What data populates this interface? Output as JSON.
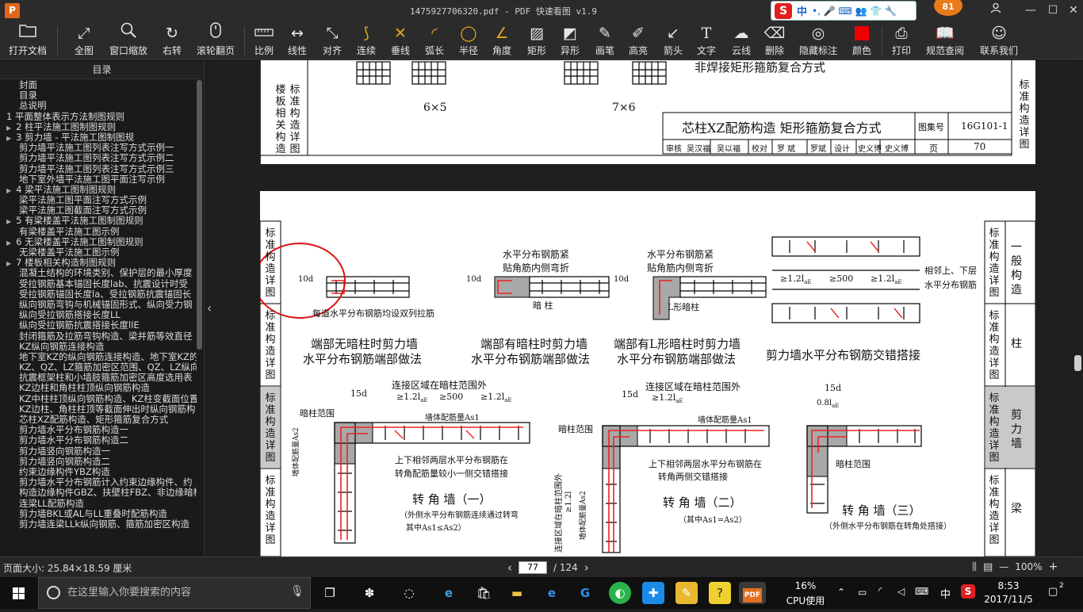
{
  "titlebar": {
    "app_icon": "P",
    "title": "1475927706320.pdf - PDF 快速看图 v1.9",
    "ime": {
      "logo": "S",
      "lang": "中",
      "symbols": "•, 🎤 ⌨ 👥 👕 🔧"
    },
    "badge": "81",
    "buttons": {
      "user": "user-icon",
      "min": "—",
      "max": "☐",
      "close": "✕"
    }
  },
  "toolbar": {
    "items": [
      {
        "label": "打开文档",
        "icon": "folder-icon"
      },
      {
        "label": "全图",
        "icon": "fit-icon"
      },
      {
        "label": "窗口缩放",
        "icon": "zoom-icon"
      },
      {
        "label": "右转",
        "icon": "rotate-right-icon"
      },
      {
        "label": "滚轮翻页",
        "icon": "mouse-icon"
      },
      {
        "label": "比例",
        "icon": "scale-icon"
      },
      {
        "label": "线性",
        "icon": "linear-icon"
      },
      {
        "label": "对齐",
        "icon": "align-icon"
      },
      {
        "label": "连续",
        "icon": "continuous-icon"
      },
      {
        "label": "垂线",
        "icon": "perpendicular-icon"
      },
      {
        "label": "弧长",
        "icon": "arc-length-icon"
      },
      {
        "label": "半径",
        "icon": "radius-icon"
      },
      {
        "label": "角度",
        "icon": "angle-icon"
      },
      {
        "label": "矩形",
        "icon": "rectangle-icon"
      },
      {
        "label": "异形",
        "icon": "irregular-icon"
      },
      {
        "label": "画笔",
        "icon": "pen-icon"
      },
      {
        "label": "高亮",
        "icon": "highlight-icon"
      },
      {
        "label": "箭头",
        "icon": "arrow-icon"
      },
      {
        "label": "文字",
        "icon": "text-icon"
      },
      {
        "label": "云线",
        "icon": "cloud-icon"
      },
      {
        "label": "删除",
        "icon": "eraser-icon"
      },
      {
        "label": "隐藏标注",
        "icon": "hide-icon"
      },
      {
        "label": "颜色",
        "icon": "color-icon",
        "color": "#ee0000"
      },
      {
        "label": "打印",
        "icon": "printer-icon"
      },
      {
        "label": "规范查阅",
        "icon": "book-icon"
      },
      {
        "label": "联系我们",
        "icon": "contact-icon"
      }
    ]
  },
  "sidebar": {
    "title": "目录",
    "items": [
      {
        "text": "封面",
        "level": 0
      },
      {
        "text": "目录",
        "level": 0
      },
      {
        "text": "总说明",
        "level": 0
      },
      {
        "text": "1 平面整体表示方法制图规则",
        "level": 1
      },
      {
        "text": "2 柱平法施工图制图规则",
        "level": 1,
        "arrow": "▶"
      },
      {
        "text": "3 剪力墙 - 平法施工图制图规",
        "level": 1,
        "arrow": "▶"
      },
      {
        "text": "剪力墙平法施工图列表注写方式示例一",
        "level": 2
      },
      {
        "text": "剪力墙平法施工图列表注写方式示例二",
        "level": 2
      },
      {
        "text": "剪力墙平法施工图列表注写方式示例三",
        "level": 2
      },
      {
        "text": "地下室外墙平法施工图平面注写示例",
        "level": 2
      },
      {
        "text": "4 梁平法施工图制图规则",
        "level": 1,
        "arrow": "▶"
      },
      {
        "text": "梁平法施工图平面注写方式示例",
        "level": 2
      },
      {
        "text": "梁平法施工图截面注写方式示例",
        "level": 2
      },
      {
        "text": "5 有梁楼盖平法施工图制图规则",
        "level": 1,
        "arrow": "▶"
      },
      {
        "text": "有梁楼盖平法施工图示例",
        "level": 2
      },
      {
        "text": "6 无梁楼盖平法施工图制图规则",
        "level": 1,
        "arrow": "▶"
      },
      {
        "text": "无梁楼盖平法施工图示例",
        "level": 2
      },
      {
        "text": "7 楼板相关构造制图规则",
        "level": 1,
        "arrow": "▶"
      },
      {
        "text": "混凝土结构的环境类别、保护层的最小厚度",
        "level": 2
      },
      {
        "text": "受拉钢筋基本锚固长度lab、抗震设计时受",
        "level": 2
      },
      {
        "text": "受拉钢筋锚固长度la、受拉钢筋抗震锚固长",
        "level": 2
      },
      {
        "text": "纵向钢筋弯钩与机械锚固形式、纵向受力钢",
        "level": 2
      },
      {
        "text": "纵向受拉钢筋搭接长度LL",
        "level": 2
      },
      {
        "text": "纵向受拉钢筋抗震搭接长度llE",
        "level": 2
      },
      {
        "text": "封闭箍筋及拉筋弯钩构造、梁并筋等效直径",
        "level": 2
      },
      {
        "text": "KZ纵向钢筋连接构造",
        "level": 2
      },
      {
        "text": "地下室KZ的纵向钢筋连接构造、地下室KZ的",
        "level": 2
      },
      {
        "text": "KZ、QZ、LZ箍筋加密区范围、QZ、LZ纵向钢",
        "level": 2
      },
      {
        "text": "抗震框架柱和小墙肢箍筋加密区高度选用表",
        "level": 2
      },
      {
        "text": "KZ边柱和角柱柱顶纵向钢筋构造",
        "level": 2
      },
      {
        "text": "KZ中柱柱顶纵向钢筋构造、KZ柱变截面位置",
        "level": 2
      },
      {
        "text": "KZ边柱、角柱柱顶等截面伸出时纵向钢筋构",
        "level": 2
      },
      {
        "text": "芯柱XZ配筋构造、矩形箍筋复合方式",
        "level": 2
      },
      {
        "text": "剪力墙水平分布钢筋构造一",
        "level": 2
      },
      {
        "text": "剪力墙水平分布钢筋构造二",
        "level": 2
      },
      {
        "text": "剪力墙竖向钢筋构造一",
        "level": 2
      },
      {
        "text": "剪力墙竖向钢筋构造二",
        "level": 2
      },
      {
        "text": "约束边缘构件YBZ构造",
        "level": 2
      },
      {
        "text": "剪力墙水平分布钢筋计入约束边缘构件、约",
        "level": 2
      },
      {
        "text": "构造边缘构件GBZ、扶壁柱FBZ、非边缘暗柱",
        "level": 2
      },
      {
        "text": "连梁LL配筋构造",
        "level": 2
      },
      {
        "text": "剪力墙BKL或AL与LL重叠时配筋构造",
        "level": 2
      },
      {
        "text": "剪力墙连梁LLk纵向钢筋、箍筋加密区构造",
        "level": 2
      }
    ]
  },
  "page1": {
    "top_label": "非焊接矩形箍筋复合方式",
    "grid_a": "6×5",
    "grid_b": "7×6",
    "left_a": "楼板相关构造",
    "left_b": "标准构造详图",
    "drawing_title": "芯柱XZ配筋构造 矩形箍筋复合方式",
    "atlas_label": "图集号",
    "atlas_no": "16G101-1",
    "roles": [
      "审核",
      "吴汉福",
      "吴以福",
      "校对",
      "罗 斌",
      "罗斌",
      "设计",
      "史义博",
      "史义博"
    ],
    "page_label": "页",
    "page_no": "70",
    "right_tab": "标准构造详图"
  },
  "page2": {
    "side_tabs_left": [
      "标准构造详图",
      "标准构造详图",
      "标准构造详图",
      "标准构造详图"
    ],
    "side_tabs_right": [
      {
        "a": "标准构造详图",
        "b": "一般构造"
      },
      {
        "a": "标准构造详图",
        "b": "柱"
      },
      {
        "a": "标准构造详图",
        "b": "剪力墙"
      },
      {
        "a": "标准构造详图",
        "b": "梁"
      }
    ],
    "fig1": {
      "dim": "10d",
      "note": "每道水平分布钢筋均设双列拉筋",
      "title1": "端部无暗柱时剪力墙",
      "title2": "水平分布钢筋端部做法"
    },
    "fig2": {
      "note1": "水平分布钢筋紧",
      "note2": "贴角筋内侧弯折",
      "dim": "10d",
      "col": "暗 柱",
      "title1": "端部有暗柱时剪力墙",
      "title2": "水平分布钢筋端部做法"
    },
    "fig3": {
      "note1": "水平分布钢筋紧",
      "note2": "贴角筋内侧弯折",
      "dim": "10d",
      "col": "L形暗柱",
      "title1": "端部有L形暗柱时剪力墙",
      "title2": "水平分布钢筋端部做法"
    },
    "fig4": {
      "d1": "≥1.2l",
      "d2": "≥500",
      "d3": "≥1.2l",
      "sub": "aE",
      "note1": "相邻上、下层",
      "note2": "水平分布钢筋",
      "title": "剪力墙水平分布钢筋交错搭接"
    },
    "fig5": {
      "top": "连接区域在暗柱范围外",
      "d15": "15d",
      "d1": "≥1.2l",
      "d2": "≥500",
      "d3": "≥1.2l",
      "sub": "aE",
      "range": "暗柱范围",
      "as1": "墙体配筋量As1",
      "as2": "墙体配筋量As2",
      "n1": "上下相邻两层水平分布钢筋在",
      "n2": "转角配筋量较小一侧交错搭接",
      "title": "转 角 墙（一）",
      "sub1": "（外侧水平分布钢筋连续通过转弯",
      "sub2": "其中As1≤As2）"
    },
    "fig6": {
      "top": "连接区域在暗柱范围外",
      "d15": "15d",
      "d1": "≥1.2l",
      "sub": "aE",
      "range": "暗柱范围",
      "as1": "墙体配筋量As1",
      "as2": "墙体配筋量As2",
      "vz": "连接区域在暗柱范围外",
      "vd": "≥1.2l",
      "n1": "上下相邻两层水平分布钢筋在",
      "n2": "转角两侧交错搭接",
      "title": "转 角 墙（二）",
      "sub1": "（其中As1=As2）"
    },
    "fig7": {
      "d15": "15d",
      "d08": "0.8l",
      "sub": "aE",
      "range": "暗柱范围",
      "title": "转 角 墙（三）",
      "sub1": "（外侧水平分布钢筋在转角处搭接）"
    }
  },
  "statusbar": {
    "page_size": "页面大小: 25.84×18.59 厘米",
    "current_page": "77",
    "total_pages": "/ 124",
    "prev": "‹",
    "next": "›",
    "zoom": "100%",
    "zoom_out": "—",
    "zoom_in": "+"
  },
  "taskbar": {
    "search_placeholder": "在这里输入你要搜索的内容",
    "cpu_pct": "16%",
    "cpu_label": "CPU使用",
    "ime": "中",
    "time": "8:53",
    "date": "2017/11/5",
    "notify": "2"
  }
}
